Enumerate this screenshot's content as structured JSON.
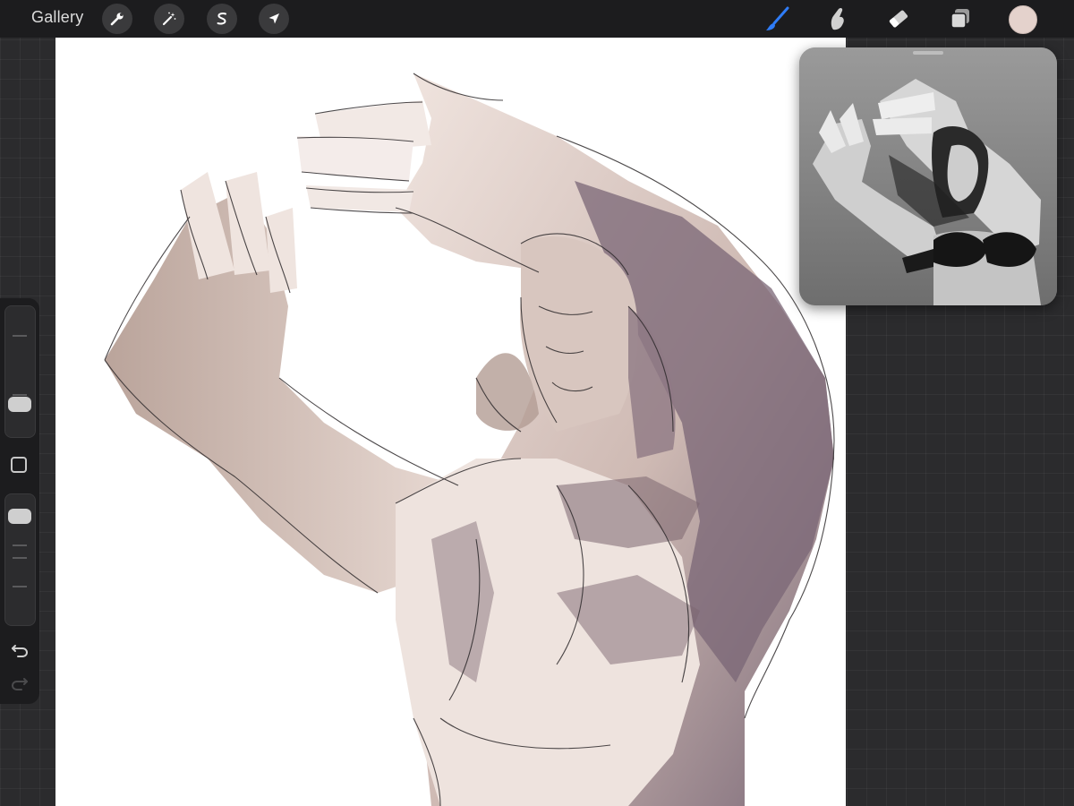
{
  "topbar": {
    "gallery_label": "Gallery",
    "left_tools": [
      {
        "name": "actions",
        "icon": "wrench-icon"
      },
      {
        "name": "adjustments",
        "icon": "magic-wand-icon"
      },
      {
        "name": "selection",
        "icon": "selection-s-icon"
      },
      {
        "name": "transform",
        "icon": "arrow-cursor-icon"
      }
    ],
    "right_tools": [
      {
        "name": "brush",
        "icon": "brush-icon",
        "active": true
      },
      {
        "name": "smudge",
        "icon": "smudge-finger-icon",
        "active": false
      },
      {
        "name": "eraser",
        "icon": "eraser-icon",
        "active": false
      },
      {
        "name": "layers",
        "icon": "layers-icon",
        "active": false
      }
    ],
    "current_color": "#e4d2cc"
  },
  "colors": {
    "accent": "#2f7cf6",
    "toolbar_bg": "#1c1c1e",
    "workspace_bg": "#2b2b2d"
  },
  "sidebar": {
    "brush_size_level": 0.2,
    "opacity_level": 0.9,
    "modify_icon": "square-modify-icon",
    "undo_icon": "undo-arrow-icon",
    "redo_icon": "redo-arrow-icon"
  },
  "reference": {
    "visible": true,
    "mode": "image"
  }
}
